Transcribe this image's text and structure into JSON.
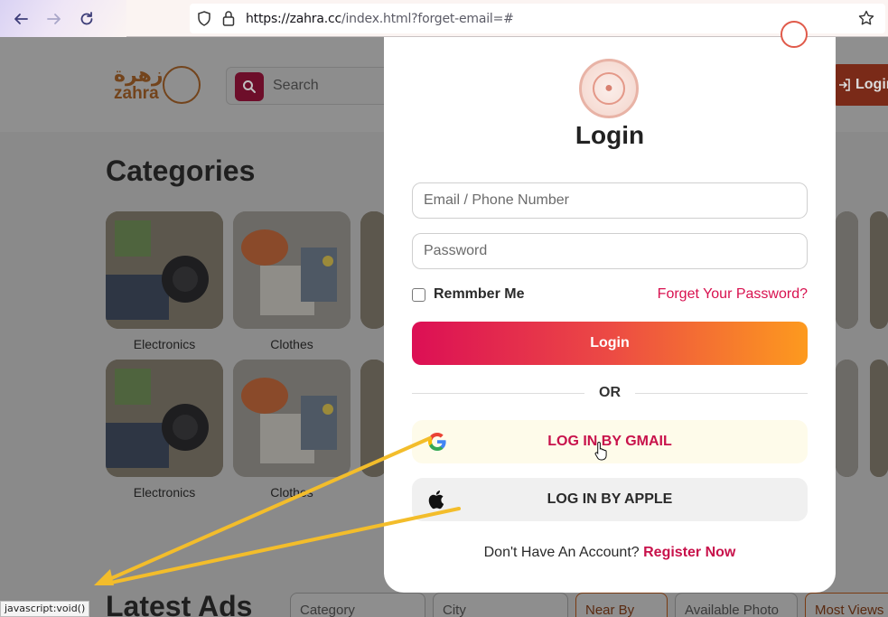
{
  "browser": {
    "url_host": "https://zahra.cc",
    "url_path": "/index.html?forget-email=#"
  },
  "header": {
    "logo_ar": "زهرة",
    "logo_en": "zahra",
    "search_placeholder": "Search",
    "login_label": "Login"
  },
  "categories": {
    "title": "Categories",
    "items": [
      {
        "label": "Electronics"
      },
      {
        "label": "Clothes"
      },
      {
        "label": "Electronics"
      },
      {
        "label": "Clothes"
      }
    ]
  },
  "latest_ads": {
    "title": "Latest Ads",
    "filters": [
      "Category",
      "City",
      "Near By",
      "Available Photo",
      "Most Views"
    ]
  },
  "modal": {
    "title": "Login",
    "email_placeholder": "Email / Phone Number",
    "password_placeholder": "Password",
    "remember_label": "Remmber Me",
    "forgot_label": "Forget Your Password?",
    "login_button": "Login",
    "or_text": "OR",
    "gmail_button": "LOG IN BY GMAIL",
    "apple_button": "LOG IN BY APPLE",
    "no_account_text": "Don't Have An Account?",
    "register_link": "Register Now"
  },
  "status_bar": {
    "text": "javascript:void()"
  },
  "colors": {
    "accent": "#d8114f",
    "gradient_start": "#dc0f55",
    "gradient_end": "#fd9a1e",
    "arrow": "#f3bd2b"
  }
}
